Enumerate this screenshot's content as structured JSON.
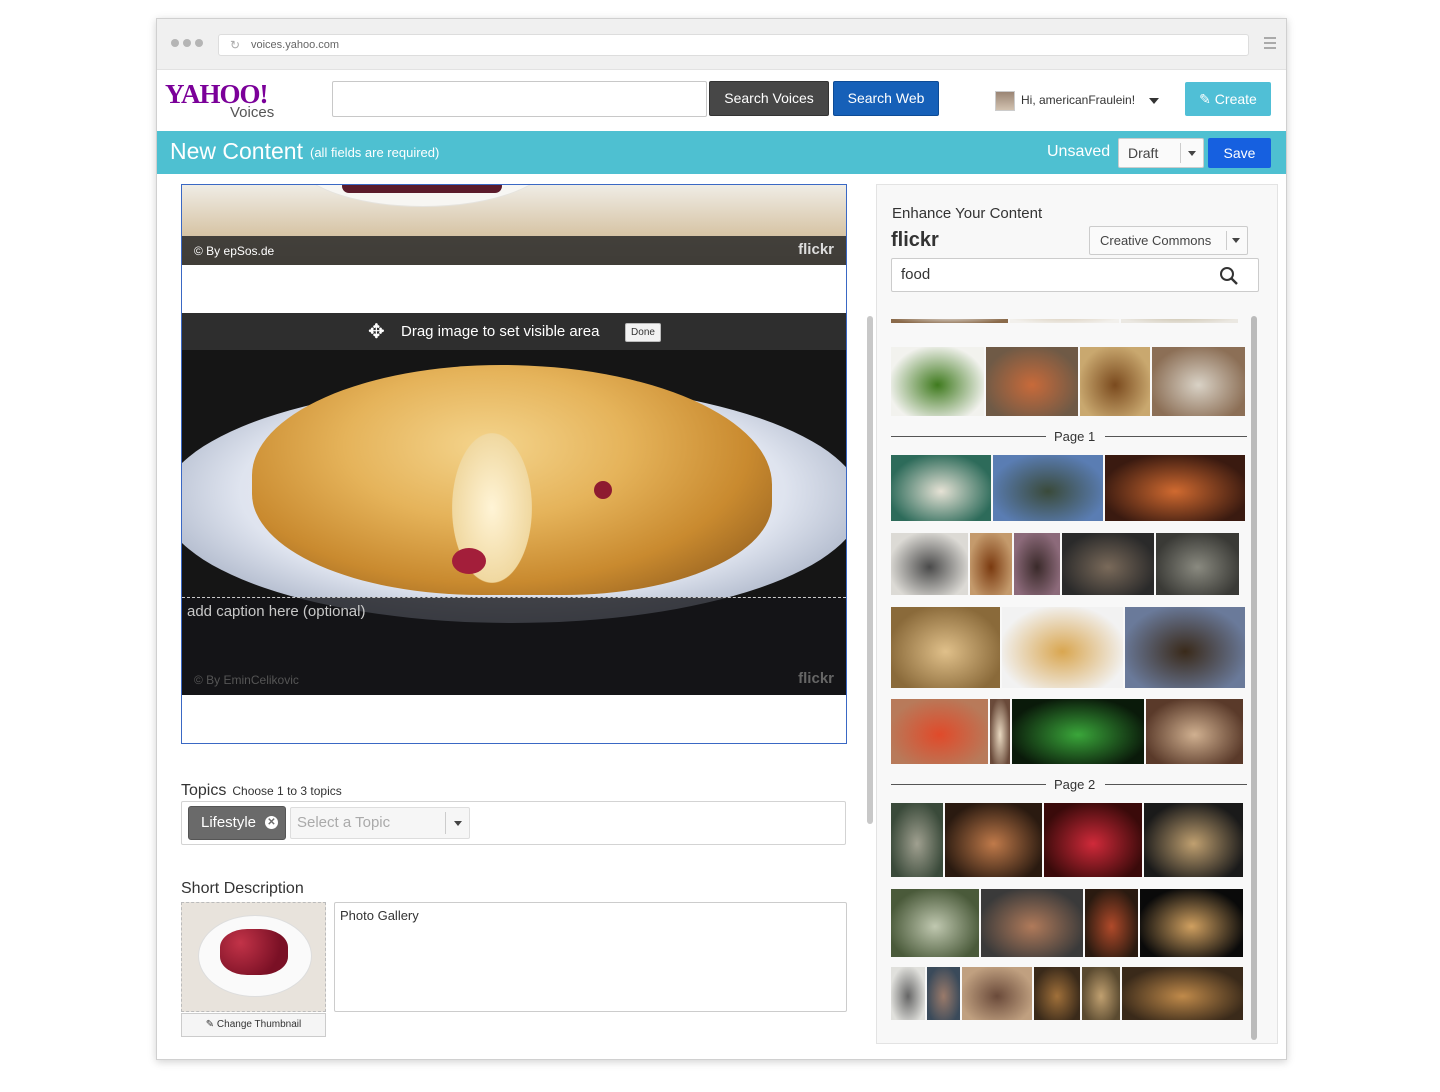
{
  "browser": {
    "url": "voices.yahoo.com"
  },
  "header": {
    "logo_yahoo": "YAHOO!",
    "logo_voices": "Voices",
    "search_placeholder": "",
    "search_voices_label": "Search Voices",
    "search_web_label": "Search Web",
    "greeting": "Hi, americanFraulein!",
    "create_label": "Create"
  },
  "toolbar": {
    "title": "New Content",
    "subtitle": "(all fields are required)",
    "status": "Unsaved",
    "draft_select": "Draft",
    "save_label": "Save"
  },
  "editor": {
    "top_credit": "© By epSos.de",
    "flickr_badge": "flickr",
    "drag_hint": "Drag image to set visible area",
    "done_label": "Done",
    "caption_placeholder": "add caption here (optional)",
    "photo_credit": "© By EminCelikovic",
    "topics_label": "Topics",
    "topics_hint": "Choose 1 to 3 topics",
    "topic_tag": "Lifestyle",
    "topic_select_placeholder": "Select a Topic",
    "short_desc_label": "Short Description",
    "change_thumbnail": "Change Thumbnail",
    "description_value": "Photo Gallery"
  },
  "enhance": {
    "title": "Enhance Your Content",
    "source": "flickr",
    "license_select": "Creative Commons",
    "query": "food",
    "page_labels": [
      "Page 1",
      "Page 2"
    ]
  },
  "colors": {
    "accent_bar": "#4ec0d1",
    "save_blue": "#1660e0",
    "search_web_blue": "#1660b8",
    "yahoo_purple": "#7b0099"
  },
  "thumb_rows": [
    [
      {
        "w": 93,
        "c1": "#f2f2ee",
        "c2": "#3f7a1e"
      },
      {
        "w": 92,
        "c1": "#6f5a46",
        "c2": "#c86a3a"
      },
      {
        "w": 70,
        "c1": "#c9a86f",
        "c2": "#7a4a1e"
      },
      {
        "w": 93,
        "c1": "#8c6f56",
        "c2": "#d9d2c6"
      }
    ],
    [
      {
        "w": 100,
        "c1": "#2d6b5a",
        "c2": "#e6e2d5"
      },
      {
        "w": 110,
        "c1": "#5a7db3",
        "c2": "#3a4a3a"
      },
      {
        "w": 140,
        "c1": "#3a1a10",
        "c2": "#d06a30"
      }
    ],
    [
      {
        "w": 77,
        "c1": "#dcdad5",
        "c2": "#4a4a4a"
      },
      {
        "w": 42,
        "c1": "#c49a6c",
        "c2": "#7a3a10"
      },
      {
        "w": 46,
        "c1": "#8c6a7a",
        "c2": "#3a2a2a"
      },
      {
        "w": 92,
        "c1": "#2a2a2a",
        "c2": "#7a6a5a"
      },
      {
        "w": 83,
        "c1": "#3a3a36",
        "c2": "#8a8a80"
      }
    ],
    [
      {
        "w": 109,
        "c1": "#8a6a3a",
        "c2": "#e0c08a"
      },
      {
        "w": 121,
        "c1": "#f2f2f2",
        "c2": "#d9a650"
      },
      {
        "w": 120,
        "c1": "#6a7a9a",
        "c2": "#3a2a1a"
      }
    ],
    [
      {
        "w": 97,
        "c1": "#b87a5a",
        "c2": "#e04a2a"
      },
      {
        "w": 20,
        "c1": "#6a4a3a",
        "c2": "#e8d8c0"
      },
      {
        "w": 132,
        "c1": "#0a1a0a",
        "c2": "#3aa63a"
      },
      {
        "w": 97,
        "c1": "#5a3a2a",
        "c2": "#d0b090"
      }
    ],
    [
      {
        "w": 52,
        "c1": "#3a4a3a",
        "c2": "#a0a090"
      },
      {
        "w": 97,
        "c1": "#2a1a10",
        "c2": "#c07a4a"
      },
      {
        "w": 98,
        "c1": "#3a0a0a",
        "c2": "#d02a3a"
      },
      {
        "w": 99,
        "c1": "#1a1a1a",
        "c2": "#c0a070"
      }
    ],
    [
      {
        "w": 88,
        "c1": "#4a5a3a",
        "c2": "#c0c8b0"
      },
      {
        "w": 102,
        "c1": "#3a3a3a",
        "c2": "#b07a5a"
      },
      {
        "w": 53,
        "c1": "#2a1a10",
        "c2": "#b04a2a"
      },
      {
        "w": 103,
        "c1": "#0a0a0a",
        "c2": "#d0a060"
      }
    ],
    [
      {
        "w": 34,
        "c1": "#e0e0dc",
        "c2": "#666666"
      },
      {
        "w": 33,
        "c1": "#3a4a5a",
        "c2": "#9a7a6a"
      },
      {
        "w": 70,
        "c1": "#c0a080",
        "c2": "#6a4a3a"
      },
      {
        "w": 46,
        "c1": "#3a2a1a",
        "c2": "#a0703a"
      },
      {
        "w": 38,
        "c1": "#5a4a30",
        "c2": "#c0a070"
      },
      {
        "w": 121,
        "c1": "#3a2a1a",
        "c2": "#c08a4a"
      }
    ]
  ]
}
